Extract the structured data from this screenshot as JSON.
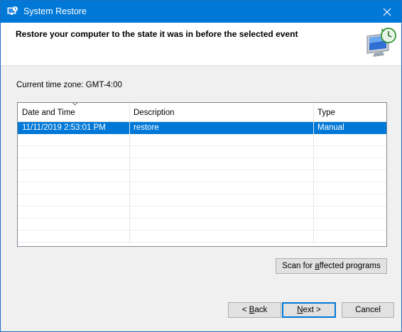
{
  "window": {
    "title": "System Restore"
  },
  "header": {
    "heading": "Restore your computer to the state it was in before the selected event"
  },
  "timezone_label": "Current time zone: GMT-4:00",
  "list": {
    "columns": [
      "Date and Time",
      "Description",
      "Type"
    ],
    "rows": [
      [
        "11/11/2019 2:53:01 PM",
        "restore",
        "Manual"
      ]
    ],
    "selected_row": 0
  },
  "buttons": {
    "scan_prefix": "Scan for ",
    "scan_accel": "a",
    "scan_suffix": "ffected programs",
    "back_prefix": "< ",
    "back_accel": "B",
    "back_suffix": "ack",
    "next_accel": "N",
    "next_suffix": "ext >",
    "cancel": "Cancel"
  },
  "colors": {
    "accent": "#0078d7",
    "window_bg": "#f0f0f0"
  },
  "icons": {
    "app": "system-restore-icon",
    "close": "close-icon",
    "graphic": "restore-monitor-clock-icon",
    "sort": "sort-descending-icon"
  }
}
